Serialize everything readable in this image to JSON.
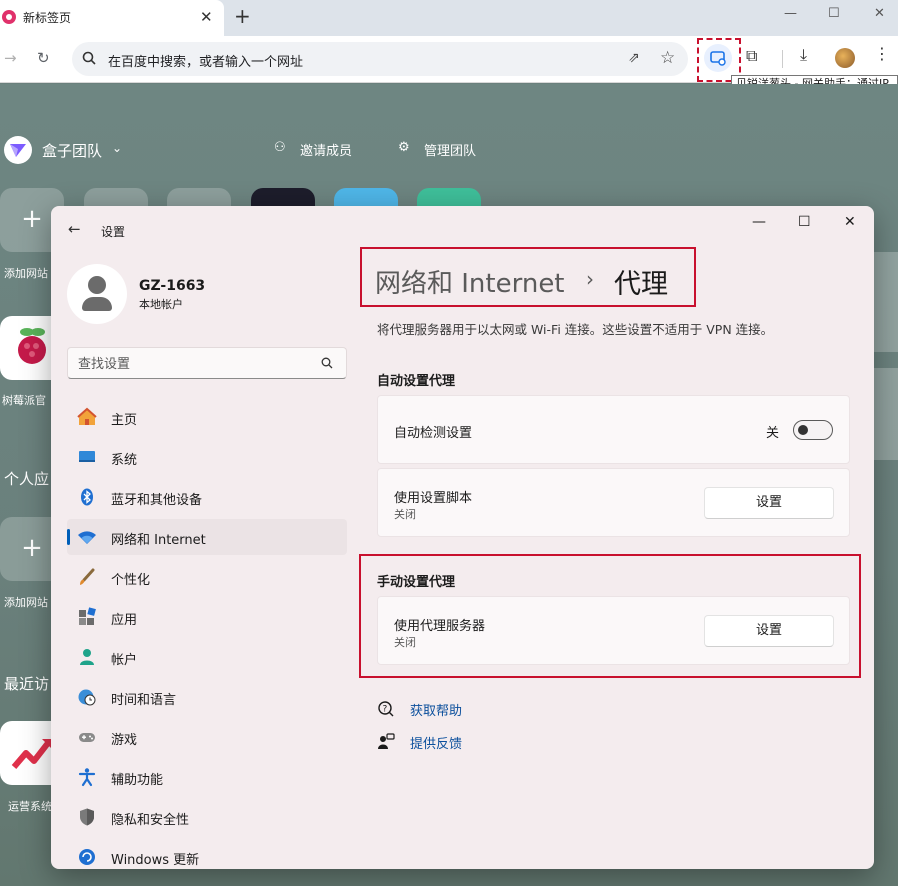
{
  "browser": {
    "tab_title": "新标签页",
    "tab_close": "✕",
    "new_tab": "+",
    "window_controls": {
      "minimize": "—",
      "maximize": "☐",
      "close": "✕"
    },
    "omnibox_placeholder": "在百度中搜索，或者输入一个网址",
    "tooltip": "贝锐洋葱头 - 网关助手：通过IP"
  },
  "ntp": {
    "team_name": "盒子团队",
    "invite": "邀请成员",
    "manage": "管理团队",
    "tiles_row1": [
      "添加网站",
      "树莓派官"
    ],
    "heading_personal": "个人应",
    "tile_add2": "添加网站",
    "heading_recent": "最近访",
    "tile_ops": "运营系统"
  },
  "settings": {
    "title": "设置",
    "controls": {
      "minimize": "—",
      "maximize": "☐",
      "close": "✕"
    },
    "profile": {
      "name": "GZ-1663",
      "type": "本地帐户"
    },
    "search_placeholder": "查找设置",
    "nav": [
      {
        "label": "主页",
        "icon": "home-icon"
      },
      {
        "label": "系统",
        "icon": "system-icon"
      },
      {
        "label": "蓝牙和其他设备",
        "icon": "bluetooth-icon"
      },
      {
        "label": "网络和 Internet",
        "icon": "wifi-icon",
        "active": true
      },
      {
        "label": "个性化",
        "icon": "brush-icon"
      },
      {
        "label": "应用",
        "icon": "apps-icon"
      },
      {
        "label": "帐户",
        "icon": "account-icon"
      },
      {
        "label": "时间和语言",
        "icon": "globe-clock-icon"
      },
      {
        "label": "游戏",
        "icon": "gamepad-icon"
      },
      {
        "label": "辅助功能",
        "icon": "accessibility-icon"
      },
      {
        "label": "隐私和安全性",
        "icon": "shield-icon"
      },
      {
        "label": "Windows 更新",
        "icon": "update-icon"
      }
    ],
    "breadcrumb": {
      "parent": "网络和 Internet",
      "separator": "›",
      "current": "代理"
    },
    "description": "将代理服务器用于以太网或 Wi-Fi 连接。这些设置不适用于 VPN 连接。",
    "auto_section": {
      "heading": "自动设置代理",
      "detect": {
        "label": "自动检测设置",
        "state": "关"
      },
      "script": {
        "label": "使用设置脚本",
        "sub": "关闭",
        "button": "设置"
      }
    },
    "manual_section": {
      "heading": "手动设置代理",
      "proxy": {
        "label": "使用代理服务器",
        "sub": "关闭",
        "button": "设置"
      }
    },
    "help": {
      "get_help": "获取帮助",
      "feedback": "提供反馈"
    }
  }
}
